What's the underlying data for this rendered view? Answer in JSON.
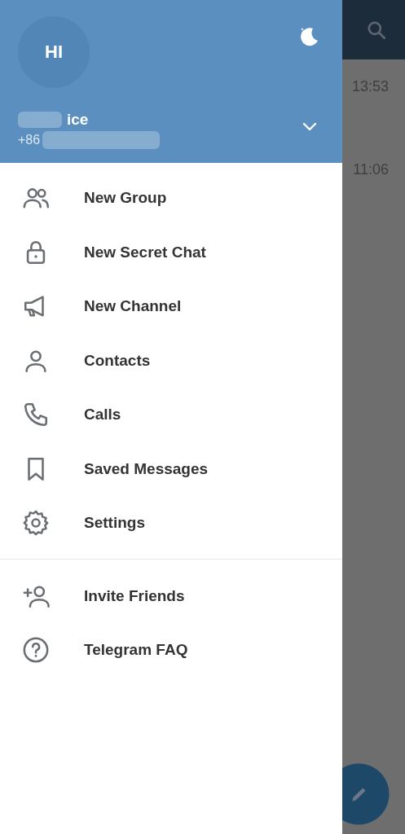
{
  "chat_list": {
    "times": [
      "13:53",
      "11:06"
    ]
  },
  "drawer": {
    "header": {
      "avatar_initials": "HI",
      "name": "ice",
      "phone": "+86"
    },
    "menu_sections": [
      {
        "items": [
          {
            "label": "New Group"
          },
          {
            "label": "New Secret Chat"
          },
          {
            "label": "New Channel"
          },
          {
            "label": "Contacts"
          },
          {
            "label": "Calls"
          },
          {
            "label": "Saved Messages"
          },
          {
            "label": "Settings"
          }
        ]
      },
      {
        "items": [
          {
            "label": "Invite Friends"
          },
          {
            "label": "Telegram FAQ"
          }
        ]
      }
    ]
  }
}
